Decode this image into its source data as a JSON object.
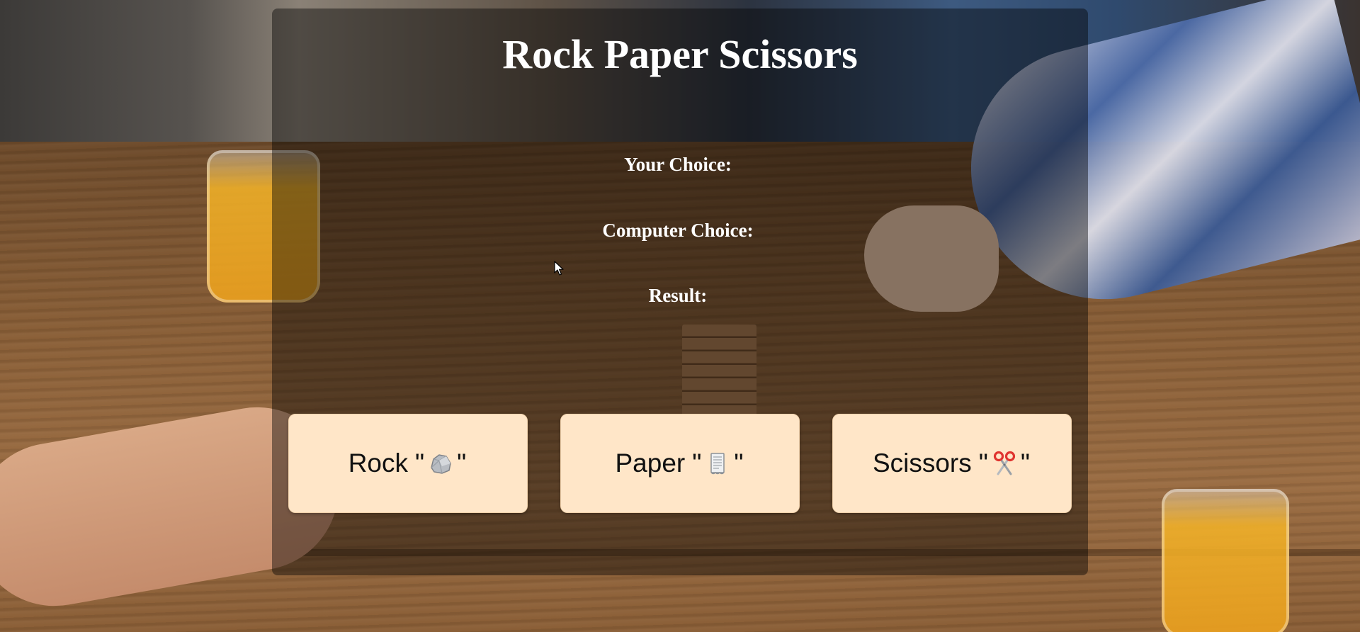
{
  "page": {
    "title": "Rock Paper Scissors"
  },
  "status": {
    "your_choice_label": "Your Choice:",
    "your_choice_value": "",
    "computer_choice_label": "Computer Choice:",
    "computer_choice_value": "",
    "result_label": "Result:",
    "result_value": ""
  },
  "choices": [
    {
      "label": "Rock",
      "quote_open": "\"",
      "quote_close": "\"",
      "icon": "rock-icon"
    },
    {
      "label": "Paper",
      "quote_open": "\"",
      "quote_close": "\"",
      "icon": "paper-scroll-icon"
    },
    {
      "label": "Scissors",
      "quote_open": "\"",
      "quote_close": "\"",
      "icon": "scissors-icon"
    }
  ],
  "colors": {
    "button_bg": "#ffe6c8",
    "panel_overlay": "rgba(0,0,0,0.42)",
    "title_text": "#ffffff",
    "button_text": "#111111"
  }
}
